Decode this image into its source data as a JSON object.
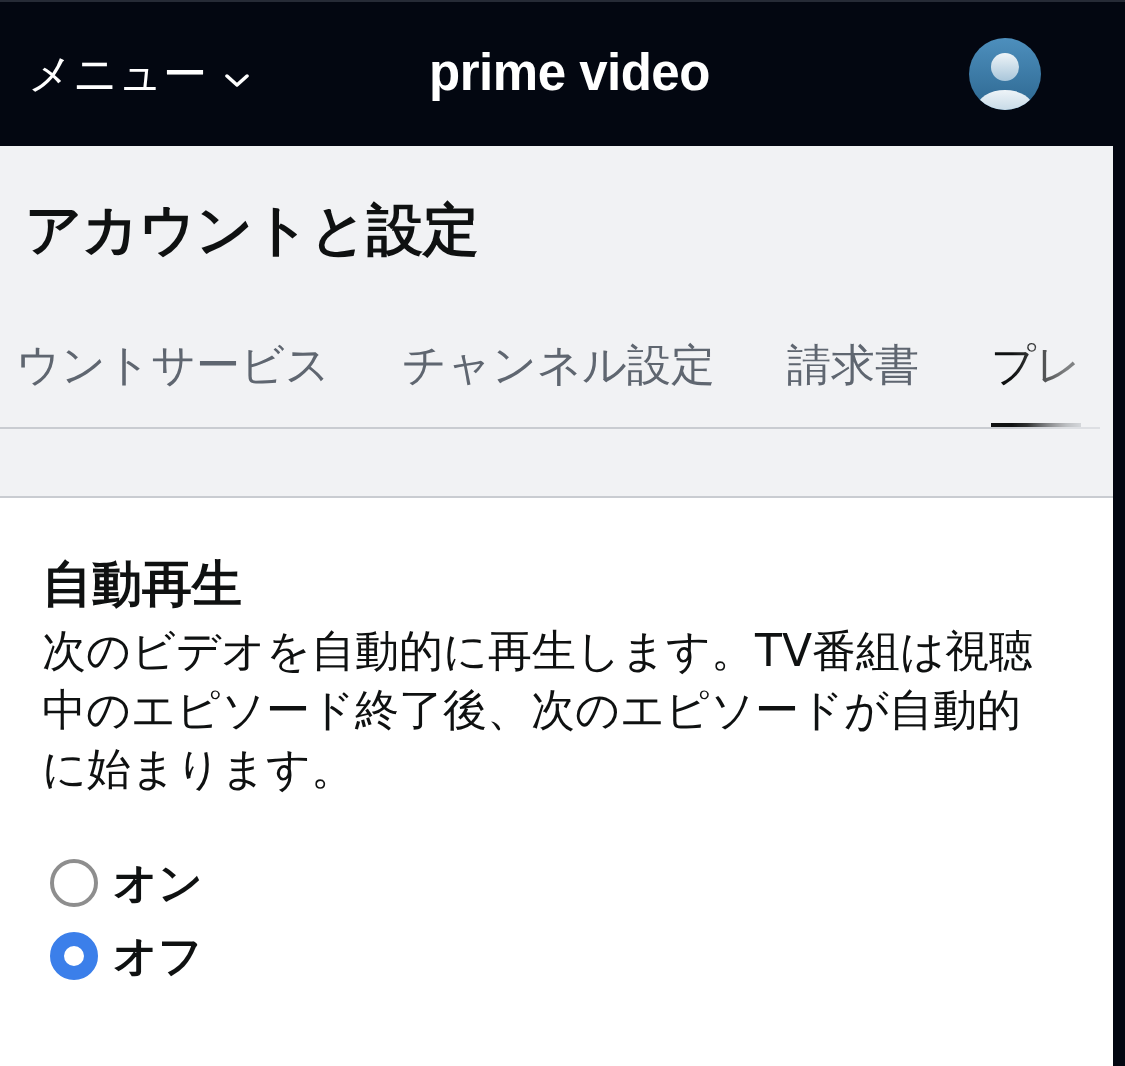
{
  "header": {
    "menu_label": "メニュー",
    "logo": "prime video"
  },
  "page": {
    "title": "アカウントと設定",
    "tabs": [
      {
        "label": "ウントサービス",
        "selected": false
      },
      {
        "label": "チャンネル設定",
        "selected": false
      },
      {
        "label": "請求書",
        "selected": false
      },
      {
        "label": "プレ",
        "selected": true
      }
    ]
  },
  "section": {
    "heading": "自動再生",
    "description": "次のビデオを自動的に再生します。TV番組は視聴中のエピソード終了後、次のエピソードが自動的に始まります。",
    "options": [
      {
        "label": "オン",
        "selected": false
      },
      {
        "label": "オフ",
        "selected": true
      }
    ]
  }
}
